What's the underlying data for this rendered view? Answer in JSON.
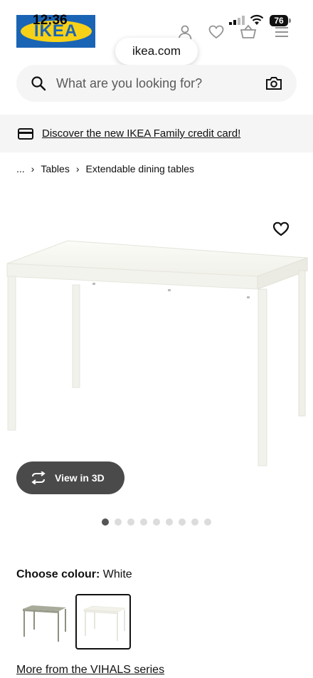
{
  "status_bar": {
    "time": "12:36",
    "battery": "76"
  },
  "header": {
    "logo_text": "IKEA",
    "url": "ikea.com",
    "icons": [
      "profile-icon",
      "heart-icon",
      "basket-icon",
      "menu-icon"
    ]
  },
  "search": {
    "placeholder": "What are you looking for?"
  },
  "promo": {
    "text": "Discover the new IKEA Family credit card!"
  },
  "breadcrumb": {
    "ellipsis": "...",
    "items": [
      "Tables",
      "Extendable dining tables"
    ]
  },
  "product": {
    "view_3d_label": "View in 3D",
    "gallery": {
      "count": 9,
      "active_index": 0
    }
  },
  "colour": {
    "label": "Choose colour:",
    "value": "White",
    "options": [
      {
        "name": "grey-green",
        "color": "#a9ab9a",
        "selected": false
      },
      {
        "name": "white",
        "color": "#f4f4ef",
        "selected": true
      }
    ]
  },
  "series_link": "More from the VIHALS series",
  "colors": {
    "logo_blue": "#1a64b5",
    "logo_yellow": "#f7d117",
    "button_dark": "#4a4a4a"
  }
}
